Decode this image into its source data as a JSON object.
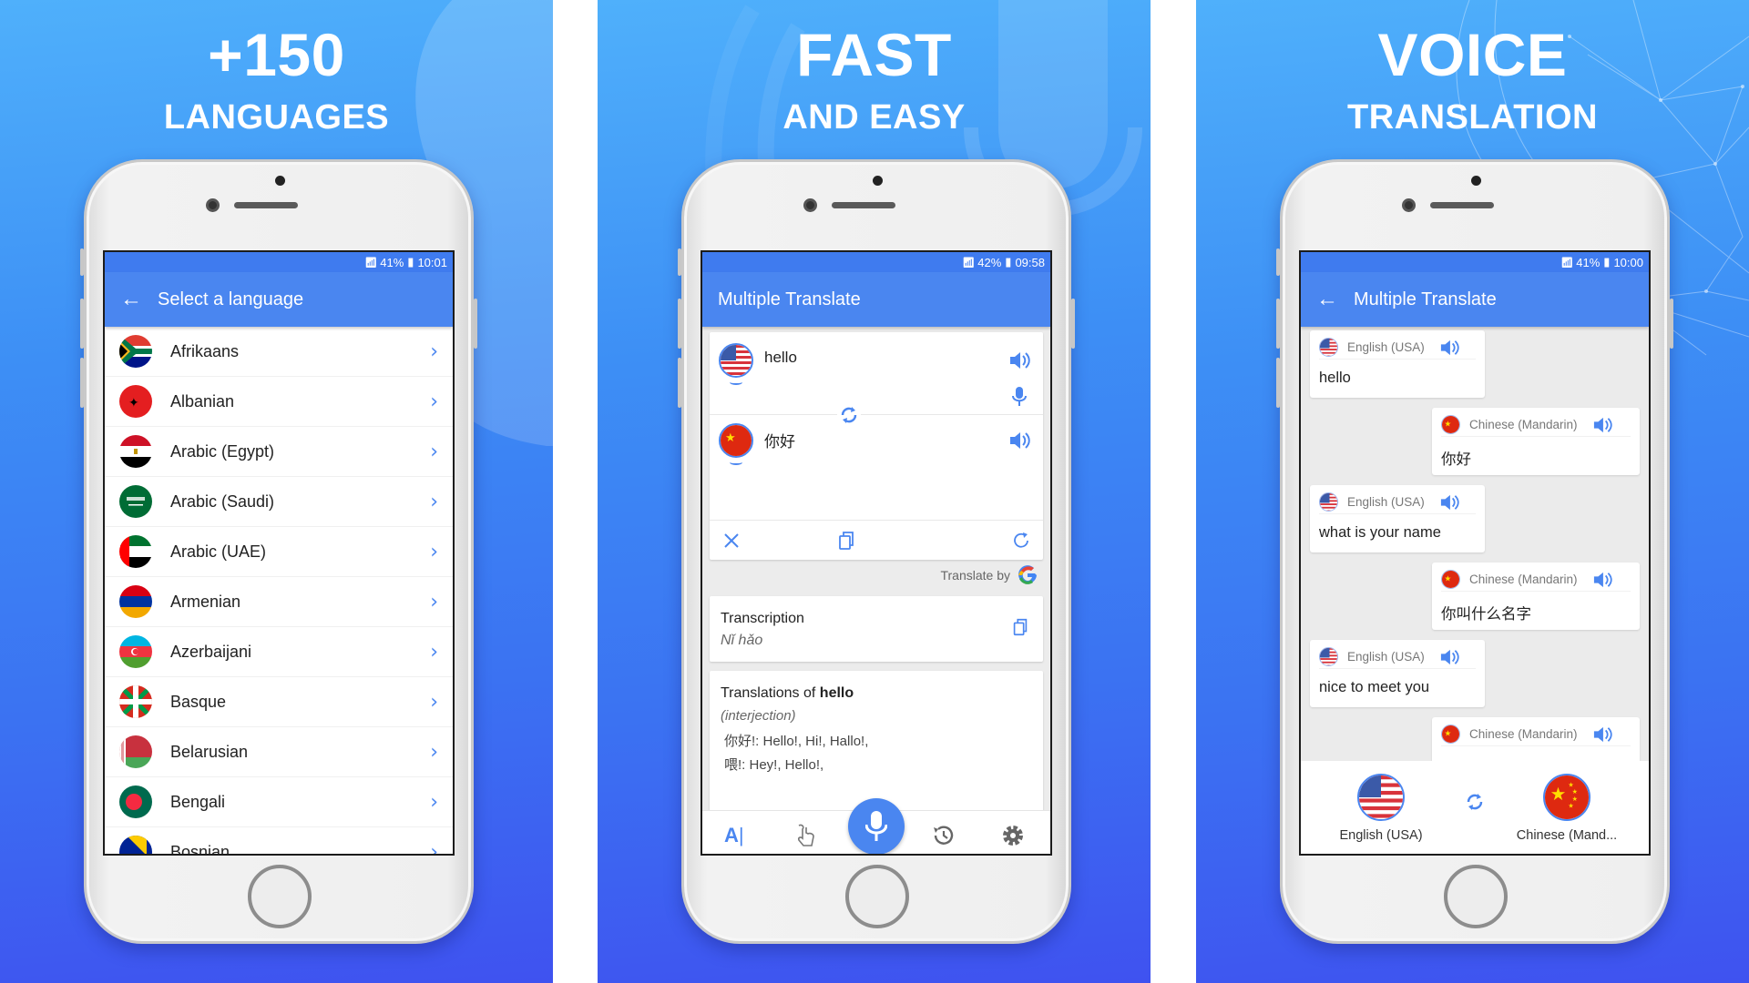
{
  "panels": [
    {
      "headline": {
        "big": "+150",
        "small": "LANGUAGES"
      },
      "status": {
        "battery": "41%",
        "time": "10:01"
      },
      "appbar": {
        "title": "Select a language",
        "has_back": true
      },
      "languages": [
        {
          "name": "Afrikaans",
          "flag": "south-africa"
        },
        {
          "name": "Albanian",
          "flag": "albania"
        },
        {
          "name": "Arabic (Egypt)",
          "flag": "egypt"
        },
        {
          "name": "Arabic (Saudi)",
          "flag": "saudi-arabia"
        },
        {
          "name": "Arabic (UAE)",
          "flag": "uae"
        },
        {
          "name": "Armenian",
          "flag": "armenia"
        },
        {
          "name": "Azerbaijani",
          "flag": "azerbaijan"
        },
        {
          "name": "Basque",
          "flag": "basque"
        },
        {
          "name": "Belarusian",
          "flag": "belarus"
        },
        {
          "name": "Bengali",
          "flag": "bangladesh"
        },
        {
          "name": "Bosnian",
          "flag": "bosnia"
        }
      ]
    },
    {
      "headline": {
        "big": "FAST",
        "small": "AND EASY"
      },
      "status": {
        "battery": "42%",
        "time": "09:58"
      },
      "appbar": {
        "title": "Multiple Translate",
        "has_back": false
      },
      "source_text": "hello",
      "target_text": "你好",
      "translate_by": "Translate by",
      "transcription_label": "Transcription",
      "transcription_value": "Nǐ hǎo",
      "translations_prefix": "Translations of ",
      "translations_word": "hello",
      "part_of_speech": "(interjection)",
      "translation_lines": [
        "你好!: Hello!, Hi!, Hallo!,",
        "喂!: Hey!, Hello!,"
      ],
      "nav": [
        "text-input",
        "handwriting",
        "voice",
        "history",
        "settings"
      ]
    },
    {
      "headline": {
        "big": "VOICE",
        "small": "TRANSLATION"
      },
      "status": {
        "battery": "41%",
        "time": "10:00"
      },
      "appbar": {
        "title": "Multiple Translate",
        "has_back": true
      },
      "conversation": [
        {
          "side": "left",
          "lang": "English (USA)",
          "text": "hello"
        },
        {
          "side": "right",
          "lang": "Chinese (Mandarin)",
          "text": "你好"
        },
        {
          "side": "left",
          "lang": "English (USA)",
          "text": "what is your name"
        },
        {
          "side": "right",
          "lang": "Chinese (Mandarin)",
          "text": "你叫什么名字"
        },
        {
          "side": "left",
          "lang": "English (USA)",
          "text": "nice to meet you"
        },
        {
          "side": "right",
          "lang": "Chinese (Mandarin)",
          "text": ""
        }
      ],
      "langbar": {
        "left": "English (USA)",
        "right": "Chinese (Mand..."
      }
    }
  ],
  "colors": {
    "accent": "#4a86f0",
    "statusbar": "#3f7bef",
    "bg_top": "#4fb0fb",
    "bg_bottom": "#3f52f0"
  }
}
